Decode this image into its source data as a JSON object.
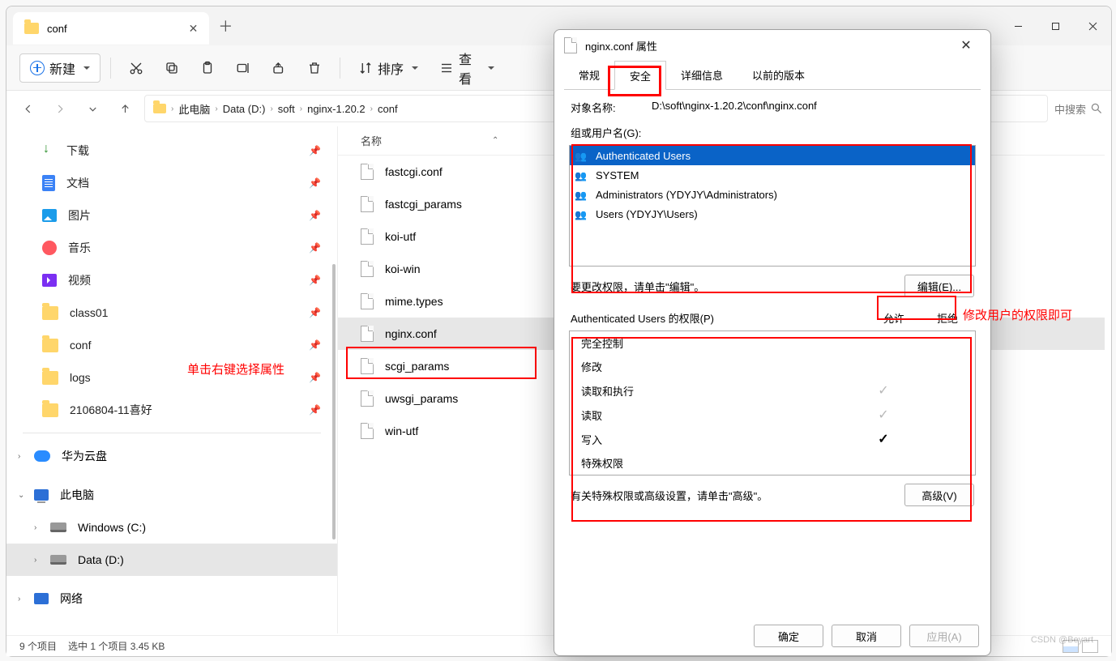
{
  "tab": {
    "title": "conf"
  },
  "toolbar": {
    "new": "新建",
    "sort": "排序",
    "view_stub": "查看"
  },
  "breadcrumbs": {
    "pc": "此电脑",
    "drive": "Data (D:)",
    "p1": "soft",
    "p2": "nginx-1.20.2",
    "p3": "conf"
  },
  "search": {
    "stub": "中搜索"
  },
  "sidebar": {
    "items": [
      {
        "label": "下载",
        "icon": "dl"
      },
      {
        "label": "文档",
        "icon": "doc"
      },
      {
        "label": "图片",
        "icon": "img"
      },
      {
        "label": "音乐",
        "icon": "music"
      },
      {
        "label": "视频",
        "icon": "vid"
      },
      {
        "label": "class01",
        "icon": "fold"
      },
      {
        "label": "conf",
        "icon": "fold"
      },
      {
        "label": "logs",
        "icon": "fold"
      },
      {
        "label": "2106804-11喜好",
        "icon": "fold"
      }
    ],
    "tree": {
      "huawei": "华为云盘",
      "pc": "此电脑",
      "winc": "Windows (C:)",
      "datad": "Data (D:)",
      "network": "网络"
    }
  },
  "filelist": {
    "header": "名称",
    "items": [
      "fastcgi.conf",
      "fastcgi_params",
      "koi-utf",
      "koi-win",
      "mime.types",
      "nginx.conf",
      "scgi_params",
      "uwsgi_params",
      "win-utf"
    ],
    "selected_index": 5
  },
  "status": {
    "count": "9 个项目",
    "sel": "选中 1 个项目  3.45 KB"
  },
  "annotations": {
    "rclick": "单击右键选择属性",
    "perm": "修改用户的权限即可"
  },
  "dialog": {
    "title": "nginx.conf 属性",
    "tabs": [
      "常规",
      "安全",
      "详细信息",
      "以前的版本"
    ],
    "object_label": "对象名称:",
    "object_path": "D:\\soft\\nginx-1.20.2\\conf\\nginx.conf",
    "group_label": "组或用户名(G):",
    "users": [
      "Authenticated Users",
      "SYSTEM",
      "Administrators (YDYJY\\Administrators)",
      "Users (YDYJY\\Users)"
    ],
    "edit_hint": "要更改权限，请单击\"编辑\"。",
    "edit_btn": "编辑(E)...",
    "perm_label": "Authenticated Users 的权限(P)",
    "col_allow": "允许",
    "col_deny": "拒绝",
    "perms": [
      {
        "name": "完全控制",
        "allow": "",
        "cls": ""
      },
      {
        "name": "修改",
        "allow": "",
        "cls": ""
      },
      {
        "name": "读取和执行",
        "allow": "✓",
        "cls": "chk-gray"
      },
      {
        "name": "读取",
        "allow": "✓",
        "cls": "chk-gray"
      },
      {
        "name": "写入",
        "allow": "✓",
        "cls": "chk-black"
      },
      {
        "name": "特殊权限",
        "allow": "",
        "cls": ""
      }
    ],
    "advanced_hint": "有关特殊权限或高级设置，请单击\"高级\"。",
    "advanced_btn": "高级(V)",
    "ok": "确定",
    "cancel": "取消",
    "apply": "应用(A)"
  },
  "watermark": "CSDN @Beyart"
}
